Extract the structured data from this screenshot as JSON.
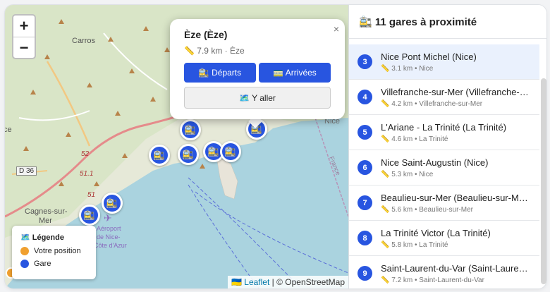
{
  "map": {
    "zoom_in": "+",
    "zoom_out": "−",
    "labels": {
      "carros": "Carros",
      "cagnes": "Cagnes-sur-",
      "mer": "Mer",
      "aeroport1": "Aéroport",
      "aeroport2": "de Nice-",
      "aeroport3": "Côte d'Azur",
      "ce": "ce",
      "france": "France",
      "nice_partial": "Nice"
    },
    "roads": {
      "d36": "D 36",
      "r52": "52",
      "r511": "51.1",
      "r51": "51"
    },
    "popup": {
      "close": "×",
      "title": "Èze (Èze)",
      "meta_icon": "📏",
      "meta": "7.9 km · Èze",
      "departures": "🚉 Départs",
      "arrivals": "🚃 Arrivées",
      "go": "🗺️ Y aller"
    },
    "legend": {
      "title": "🗺️ Légende",
      "items": [
        {
          "label": "Votre position",
          "color": "#f0a030"
        },
        {
          "label": "Gare",
          "color": "#2855e0"
        }
      ]
    },
    "attribution": {
      "flag": "🇺🇦",
      "leaflet": "Leaflet",
      "sep": " | © ",
      "osm": "OpenStreetMap"
    },
    "marker_icon": "🚉"
  },
  "panel": {
    "title": "🚉 11 gares à proximité",
    "items": [
      {
        "num": "3",
        "name": "Nice Pont Michel (Nice)",
        "meta": "📏 3.1 km • Nice"
      },
      {
        "num": "4",
        "name": "Villefranche-sur-Mer (Villefranche-sur-Mer)",
        "meta": "📏 4.2 km • Villefranche-sur-Mer"
      },
      {
        "num": "5",
        "name": "L'Ariane - La Trinité (La Trinité)",
        "meta": "📏 4.6 km • La Trinité"
      },
      {
        "num": "6",
        "name": "Nice Saint-Augustin (Nice)",
        "meta": "📏 5.3 km • Nice"
      },
      {
        "num": "7",
        "name": "Beaulieu-sur-Mer (Beaulieu-sur-Mer)",
        "meta": "📏 5.6 km • Beaulieu-sur-Mer"
      },
      {
        "num": "8",
        "name": "La Trinité Victor (La Trinité)",
        "meta": "📏 5.8 km • La Trinité"
      },
      {
        "num": "9",
        "name": "Saint-Laurent-du-Var (Saint-Laurent-du-Var)",
        "meta": "📏 7.2 km • Saint-Laurent-du-Var"
      }
    ]
  }
}
